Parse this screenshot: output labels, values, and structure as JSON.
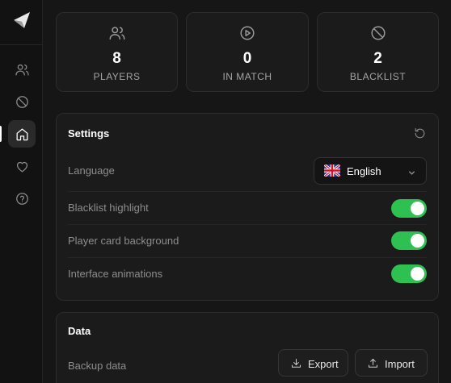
{
  "sidebar": {
    "logo": "arrow-logo",
    "items": [
      {
        "icon": "users-icon",
        "active": false
      },
      {
        "icon": "ban-icon",
        "active": false
      },
      {
        "icon": "home-icon",
        "active": true
      },
      {
        "icon": "heart-icon",
        "active": false
      },
      {
        "icon": "help-icon",
        "active": false
      }
    ]
  },
  "stats": [
    {
      "icon": "users-icon",
      "value": "8",
      "label": "PLAYERS"
    },
    {
      "icon": "play-icon",
      "value": "0",
      "label": "IN MATCH"
    },
    {
      "icon": "ban-icon",
      "value": "2",
      "label": "BLACKLIST"
    }
  ],
  "settings": {
    "title": "Settings",
    "reset_icon": "reset-icon",
    "language": {
      "label": "Language",
      "value": "English",
      "flag": "uk-flag-icon"
    },
    "toggles": [
      {
        "label": "Blacklist highlight",
        "enabled": true
      },
      {
        "label": "Player card background",
        "enabled": true
      },
      {
        "label": "Interface animations",
        "enabled": true
      }
    ]
  },
  "data": {
    "title": "Data",
    "backup_label": "Backup data",
    "export_label": "Export",
    "import_label": "Import"
  },
  "colors": {
    "background": "#161616",
    "panel": "#1b1b1b",
    "toggle_on": "#2fc052",
    "text_muted": "#8d8d8d"
  }
}
